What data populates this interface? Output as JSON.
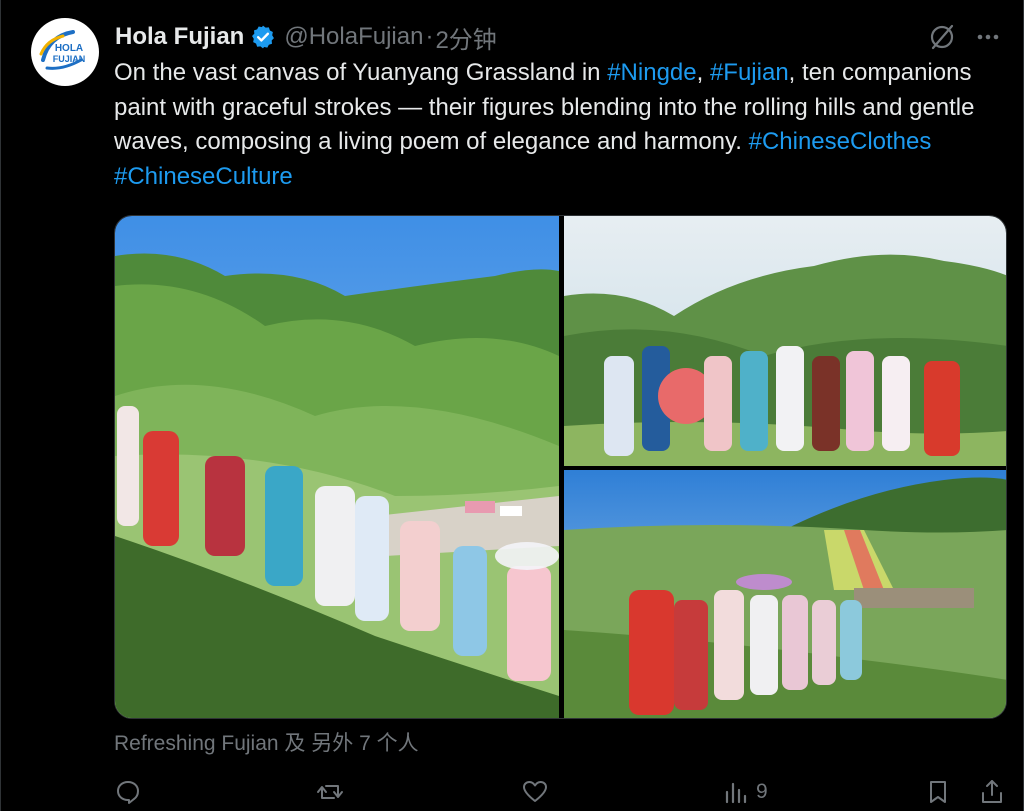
{
  "account": {
    "display_name": "Hola Fujian",
    "handle": "@HolaFujian",
    "separator": "·",
    "time_ago": "2分钟",
    "verified": true,
    "avatar_logo_line1": "HOLA",
    "avatar_logo_line2": "FUJIAN"
  },
  "tweet": {
    "text_part1": "On the vast canvas of Yuanyang Grassland in ",
    "hashtag_ningde": "#Ningde",
    "text_comma": ", ",
    "hashtag_fujian": "#Fujian",
    "text_part2": ", ten companions paint with graceful strokes — their figures blending into the rolling hills and gentle waves, composing a living poem of elegance and harmony. ",
    "hashtag_chineseclothes": "#ChineseClothes",
    "text_space": " ",
    "hashtag_chineseculture": "#ChineseCulture"
  },
  "media": {
    "photo_count": 3
  },
  "tagged_users": "Refreshing Fujian 及 另外 7 个人",
  "actions": {
    "views_count": "9"
  },
  "colors": {
    "background": "#000000",
    "text_primary": "#e7e9ea",
    "text_secondary": "#71767b",
    "link": "#1d9bf0",
    "verified_badge": "#1d9bf0"
  }
}
